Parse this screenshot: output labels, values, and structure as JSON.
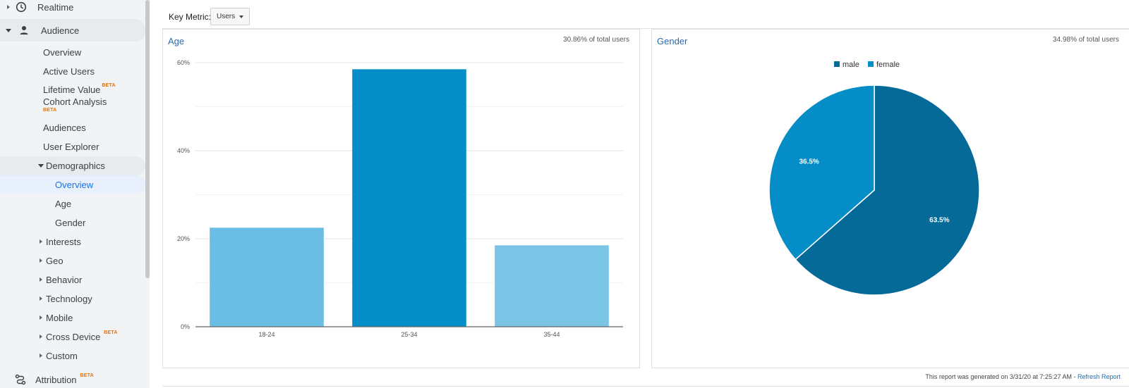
{
  "sidebar": {
    "realtime": "Realtime",
    "audience": "Audience",
    "overview": "Overview",
    "active_users": "Active Users",
    "lifetime_value": "Lifetime Value",
    "cohort_analysis": "Cohort Analysis",
    "audiences": "Audiences",
    "user_explorer": "User Explorer",
    "demographics": "Demographics",
    "demo_overview": "Overview",
    "demo_age": "Age",
    "demo_gender": "Gender",
    "interests": "Interests",
    "geo": "Geo",
    "behavior": "Behavior",
    "technology": "Technology",
    "mobile": "Mobile",
    "cross_device": "Cross Device",
    "custom": "Custom",
    "attribution": "Attribution",
    "beta": "BETA"
  },
  "toolbar": {
    "key_metric_label": "Key Metric:",
    "key_metric_value": "Users"
  },
  "age_panel": {
    "title": "Age",
    "subtitle": "30.86% of total users"
  },
  "gender_panel": {
    "title": "Gender",
    "subtitle": "34.98% of total users"
  },
  "footer": {
    "generated": "This report was generated on 3/31/20 at 7:25:27 AM - ",
    "refresh": "Refresh Report"
  },
  "colors": {
    "accent": "#2a6aad",
    "bar_light": "#6abde3",
    "bar_dark": "#058dc7",
    "pie_male": "#056a98",
    "pie_female": "#058dc7",
    "beta": "#e8710a"
  },
  "chart_data": [
    {
      "type": "bar",
      "title": "Age",
      "categories": [
        "18-24",
        "25-34",
        "35-44"
      ],
      "values": [
        22.5,
        58.5,
        18.5
      ],
      "ylim": [
        0,
        60
      ],
      "yticks": [
        "0%",
        "20%",
        "40%",
        "60%"
      ],
      "ytick_values": [
        0,
        20,
        40,
        60
      ],
      "grid": true
    },
    {
      "type": "pie",
      "title": "Gender",
      "labels": [
        "male",
        "female"
      ],
      "values": [
        63.5,
        36.5
      ],
      "value_labels": [
        "63.5%",
        "36.5%"
      ],
      "legend": "top"
    }
  ]
}
